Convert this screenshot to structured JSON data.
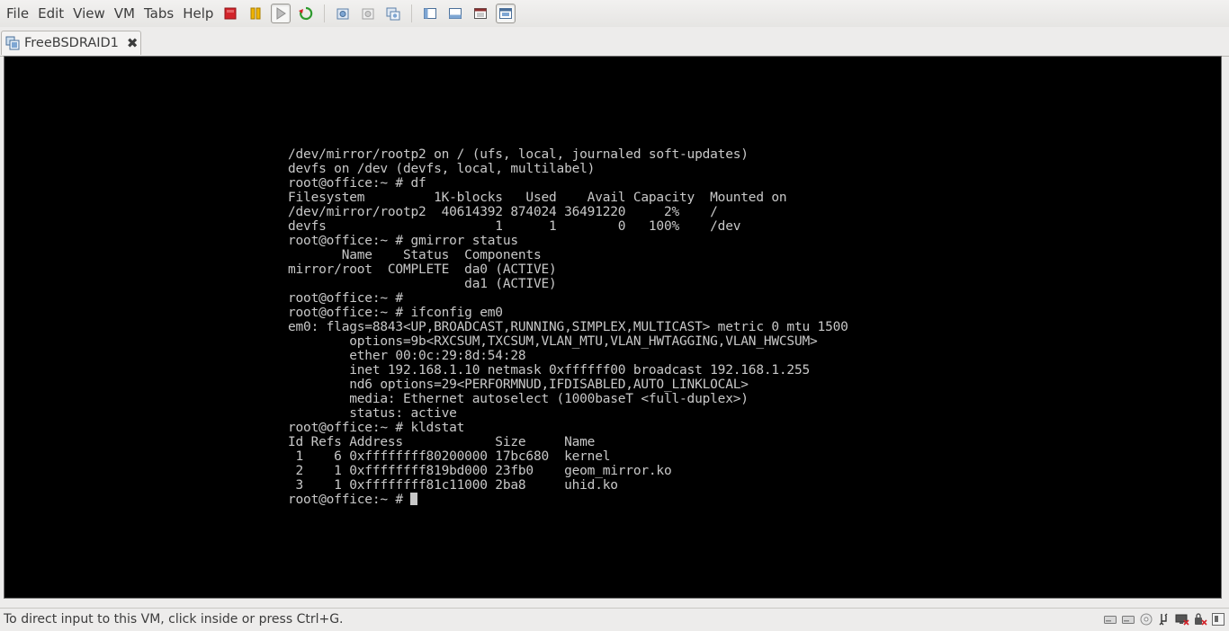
{
  "menu": {
    "file": "File",
    "edit": "Edit",
    "view": "View",
    "vm": "VM",
    "tabs": "Tabs",
    "help": "Help"
  },
  "toolbar_icons": [
    "power-off-icon",
    "suspend-icon",
    "power-on-icon",
    "reset-icon",
    "snapshot-take-icon",
    "snapshot-revert-icon",
    "snapshot-manager-icon",
    "show-sidebar-icon",
    "show-thumbnail-bar-icon",
    "fullscreen-icon",
    "unity-icon"
  ],
  "tab": {
    "label": "FreeBSDRAID1",
    "close_glyph": "✖"
  },
  "terminal": {
    "lines": [
      "/dev/mirror/rootp2 on / (ufs, local, journaled soft-updates)",
      "devfs on /dev (devfs, local, multilabel)",
      "root@office:~ # df",
      "Filesystem         1K-blocks   Used    Avail Capacity  Mounted on",
      "/dev/mirror/rootp2  40614392 874024 36491220     2%    /",
      "devfs                      1      1        0   100%    /dev",
      "root@office:~ # gmirror status",
      "       Name    Status  Components",
      "mirror/root  COMPLETE  da0 (ACTIVE)",
      "                       da1 (ACTIVE)",
      "root@office:~ #",
      "root@office:~ # ifconfig em0",
      "em0: flags=8843<UP,BROADCAST,RUNNING,SIMPLEX,MULTICAST> metric 0 mtu 1500",
      "        options=9b<RXCSUM,TXCSUM,VLAN_MTU,VLAN_HWTAGGING,VLAN_HWCSUM>",
      "        ether 00:0c:29:8d:54:28",
      "        inet 192.168.1.10 netmask 0xffffff00 broadcast 192.168.1.255",
      "        nd6 options=29<PERFORMNUD,IFDISABLED,AUTO_LINKLOCAL>",
      "        media: Ethernet autoselect (1000baseT <full-duplex>)",
      "        status: active",
      "root@office:~ # kldstat",
      "Id Refs Address            Size     Name",
      " 1    6 0xffffffff80200000 17bc680  kernel",
      " 2    1 0xffffffff819bd000 23fb0    geom_mirror.ko",
      " 3    1 0xffffffff81c11000 2ba8     uhid.ko"
    ],
    "prompt": "root@office:~ # "
  },
  "status": {
    "message": "To direct input to this VM, click inside or press Ctrl+G."
  },
  "status_icons": [
    "hard-disk-1-icon",
    "hard-disk-2-icon",
    "cd-dvd-icon",
    "usb-icon",
    "network-adapter-icon",
    "sound-card-icon",
    "vm-message-icon"
  ],
  "colors": {
    "chrome_bg": "#edeceb",
    "console_bg": "#000000",
    "console_text": "#c8c8c8",
    "power_off_red": "#d2232a",
    "suspend_yellow": "#f0b400"
  }
}
